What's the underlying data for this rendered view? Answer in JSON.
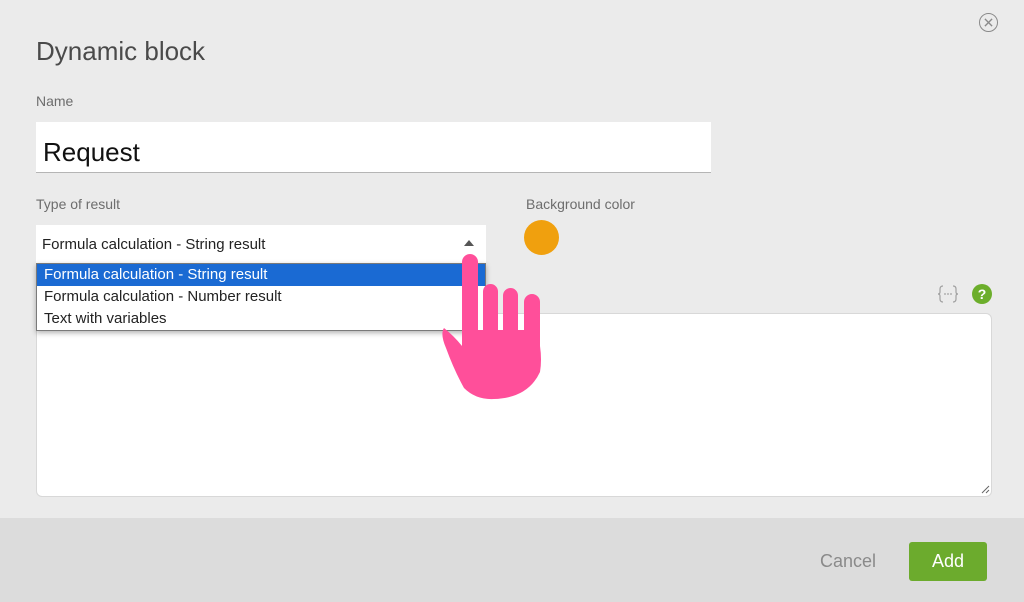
{
  "dialog": {
    "title": "Dynamic block",
    "name_label": "Name",
    "name_value": "Request",
    "type_label": "Type of result",
    "type_selected": "Formula calculation - String result",
    "type_options": [
      {
        "label": "Formula calculation - String result",
        "selected": true
      },
      {
        "label": "Formula calculation - Number result",
        "selected": false
      },
      {
        "label": "Text with variables",
        "selected": false
      }
    ],
    "bg_color_label": "Background color",
    "bg_color_value": "#f0a00e",
    "variables_icon": "braces-dots-icon",
    "help_icon": "?"
  },
  "footer": {
    "cancel_label": "Cancel",
    "add_label": "Add"
  },
  "colors": {
    "accent_green": "#6cab2d",
    "selection_blue": "#1a6ad3",
    "pointer_pink": "#ff4f9a"
  }
}
